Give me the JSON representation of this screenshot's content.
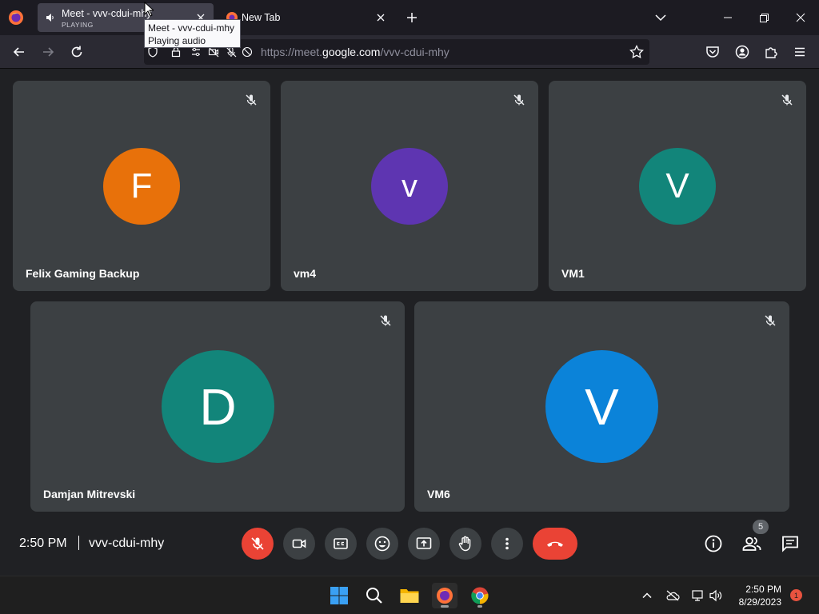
{
  "browser": {
    "tabs": [
      {
        "title": "Meet - vvv-cdui-mhy",
        "status": "PLAYING",
        "active": true
      },
      {
        "title": "New Tab",
        "active": false
      }
    ],
    "tooltip": {
      "line1": "Meet - vvv-cdui-mhy",
      "line2": "Playing audio"
    },
    "url": {
      "prefix": "https://meet.",
      "domain": "google.com",
      "path": "/vvv-cdui-mhy"
    }
  },
  "meet": {
    "participants": [
      {
        "name": "Felix Gaming Backup",
        "initial": "F",
        "color": "#e8710a",
        "muted": true
      },
      {
        "name": "vm4",
        "initial": "v",
        "color": "#5e35b1",
        "muted": true
      },
      {
        "name": "VM1",
        "initial": "V",
        "color": "#12857a",
        "muted": true
      },
      {
        "name": "Damjan Mitrevski",
        "initial": "D",
        "color": "#12857a",
        "muted": true
      },
      {
        "name": "VM6",
        "initial": "V",
        "color": "#0b83d9",
        "muted": true
      }
    ],
    "time": "2:50 PM",
    "meeting_code": "vvv-cdui-mhy",
    "participant_count": "5"
  },
  "taskbar": {
    "time": "2:50 PM",
    "date": "8/29/2023",
    "notifications": "1"
  },
  "colors": {
    "meet_bg": "#202124",
    "tile_bg": "#3c4043",
    "danger": "#ea4335"
  }
}
